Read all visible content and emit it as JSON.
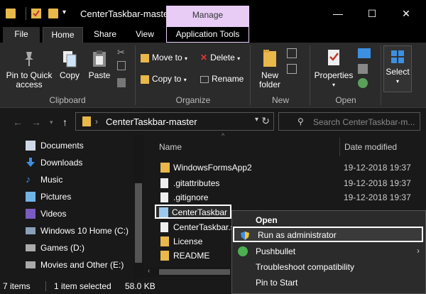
{
  "window": {
    "title": "CenterTaskbar-master",
    "manage_label": "Manage",
    "minimize": "—",
    "maximize": "☐",
    "close": "✕"
  },
  "tabs": {
    "file": "File",
    "home": "Home",
    "share": "Share",
    "view": "View",
    "app_tools": "Application Tools"
  },
  "ribbon": {
    "clipboard": {
      "pin": "Pin to Quick access",
      "copy": "Copy",
      "paste": "Paste",
      "group": "Clipboard"
    },
    "organize": {
      "move_to": "Move to",
      "copy_to": "Copy to",
      "delete": "Delete",
      "rename": "Rename",
      "group": "Organize"
    },
    "new": {
      "new_folder": "New folder",
      "group": "New"
    },
    "open": {
      "properties": "Properties",
      "group": "Open"
    },
    "select": {
      "select": "Select"
    }
  },
  "address": {
    "path": "CenterTaskbar-master",
    "search_placeholder": "Search CenterTaskbar-m..."
  },
  "nav_pane": {
    "items": [
      {
        "label": "Documents",
        "icon": "documents-icon",
        "color": "#cfd8e6"
      },
      {
        "label": "Downloads",
        "icon": "downloads-icon",
        "color": "#3d8fe0"
      },
      {
        "label": "Music",
        "icon": "music-icon",
        "color": "#3d8fe0"
      },
      {
        "label": "Pictures",
        "icon": "pictures-icon",
        "color": "#6fb4e8"
      },
      {
        "label": "Videos",
        "icon": "videos-icon",
        "color": "#7a5cc0"
      },
      {
        "label": "Windows 10 Home (C:)",
        "icon": "drive-c-icon",
        "color": "#8aa0b8"
      },
      {
        "label": "Games (D:)",
        "icon": "drive-d-icon",
        "color": "#aaa"
      },
      {
        "label": "Movies and Other (E:)",
        "icon": "drive-e-icon",
        "color": "#aaa"
      }
    ]
  },
  "file_list": {
    "columns": {
      "name": "Name",
      "date": "Date modified"
    },
    "rows": [
      {
        "name": "WindowsFormsApp2",
        "date": "19-12-2018 19:37",
        "icon": "folder-icon",
        "color": "#e8b84a"
      },
      {
        "name": ".gitattributes",
        "date": "19-12-2018 19:37",
        "icon": "file-icon",
        "color": "#eee"
      },
      {
        "name": ".gitignore",
        "date": "19-12-2018 19:37",
        "icon": "file-icon",
        "color": "#eee"
      },
      {
        "name": "CenterTaskbar",
        "date": "",
        "icon": "app-icon",
        "color": "#9cc8f0"
      },
      {
        "name": "CenterTaskbar.s",
        "date": "",
        "icon": "file-icon",
        "color": "#eee"
      },
      {
        "name": "License",
        "date": "",
        "icon": "license-icon",
        "color": "#e8b84a"
      },
      {
        "name": "README",
        "date": "",
        "icon": "readme-icon",
        "color": "#e8b84a"
      }
    ]
  },
  "status": {
    "items_count": "7 items",
    "selected": "1 item selected",
    "size": "58.0 KB"
  },
  "context_menu": {
    "open": "Open",
    "run_as_admin": "Run as administrator",
    "pushbullet": "Pushbullet",
    "troubleshoot": "Troubleshoot compatibility",
    "pin_to_start": "Pin to Start"
  },
  "colors": {
    "manage_tab": "#e8ccf6",
    "folder": "#e8b84a",
    "background": "#191919"
  }
}
